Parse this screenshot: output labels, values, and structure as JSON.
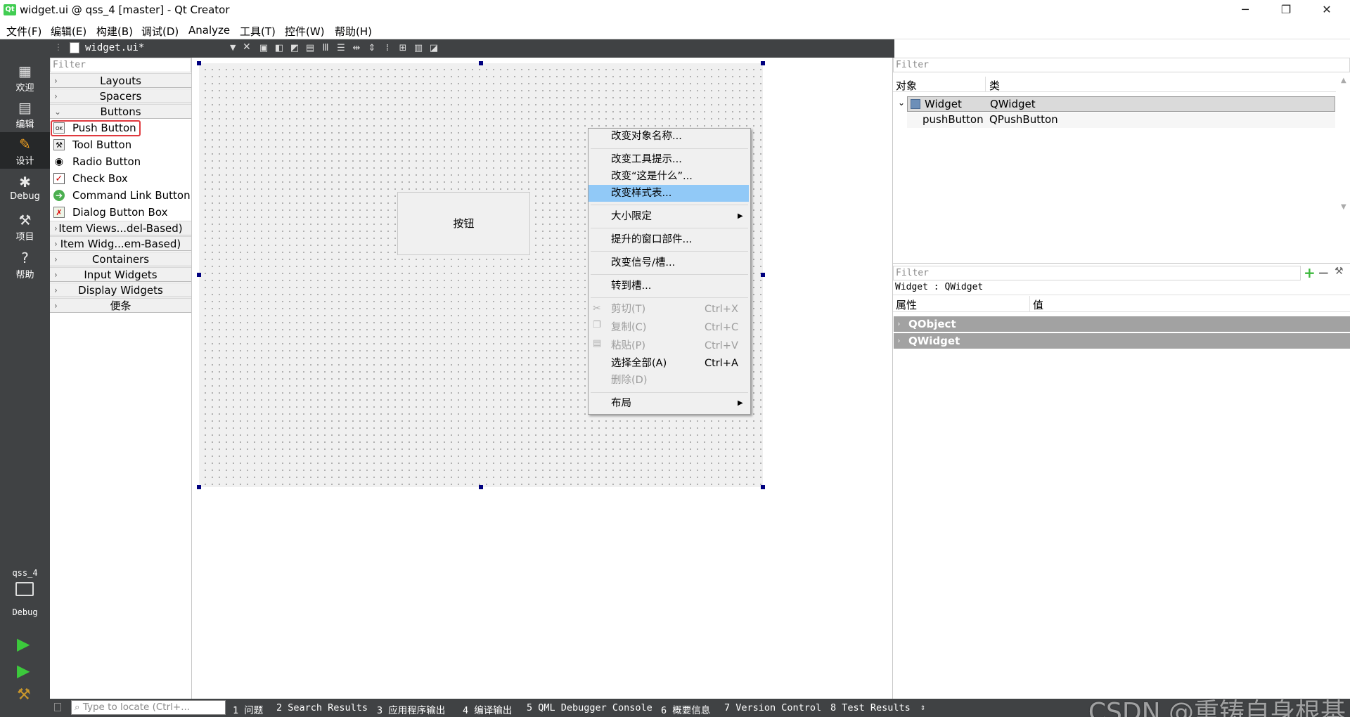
{
  "window": {
    "title": "widget.ui @ qss_4 [master] - Qt Creator",
    "app_icon": "Qt",
    "minimize": "─",
    "restore": "❐",
    "close": "✕"
  },
  "menu": [
    "文件(F)",
    "编辑(E)",
    "构建(B)",
    "调试(D)",
    "Analyze",
    "工具(T)",
    "控件(W)",
    "帮助(H)"
  ],
  "modes": [
    {
      "label": "欢迎",
      "icon": "grid-icon"
    },
    {
      "label": "编辑",
      "icon": "document-icon"
    },
    {
      "label": "设计",
      "icon": "pencil-icon"
    },
    {
      "label": "Debug",
      "icon": "bug-icon"
    },
    {
      "label": "项目",
      "icon": "wrench-icon"
    },
    {
      "label": "帮助",
      "icon": "help-icon"
    }
  ],
  "kit": {
    "project": "qss_4",
    "config": "Debug"
  },
  "editor_tab": {
    "filename": "widget.ui*"
  },
  "widget_box": {
    "filter_placeholder": "Filter",
    "categories_top": [
      "Layouts",
      "Spacers",
      "Buttons"
    ],
    "buttons": [
      "Push Button",
      "Tool Button",
      "Radio Button",
      "Check Box",
      "Command Link Button",
      "Dialog Button Box"
    ],
    "categories_bottom": [
      "Item Views...del-Based)",
      "Item Widg...em-Based)",
      "Containers",
      "Input Widgets",
      "Display Widgets",
      "便条"
    ]
  },
  "form": {
    "push_button_text": "按钮"
  },
  "context_menu": {
    "items": [
      "改变对象名称...",
      "改变工具提示...",
      "改变“这是什么”...",
      "改变样式表...",
      "大小限定",
      "提升的窗口部件...",
      "改变信号/槽...",
      "转到槽...",
      "剪切(T)",
      "复制(C)",
      "粘贴(P)",
      "选择全部(A)",
      "删除(D)",
      "布局"
    ],
    "shortcuts": {
      "cut": "Ctrl+X",
      "copy": "Ctrl+C",
      "paste": "Ctrl+V",
      "select_all": "Ctrl+A"
    },
    "highlight_color": "#91c9f7"
  },
  "object_inspector": {
    "filter_placeholder": "Filter",
    "col_object": "对象",
    "col_class": "类",
    "rows": [
      {
        "object": "Widget",
        "class": "QWidget"
      },
      {
        "object": "pushButton",
        "class": "QPushButton"
      }
    ]
  },
  "property_editor": {
    "filter_placeholder": "Filter",
    "context": "Widget : QWidget",
    "col_property": "属性",
    "col_value": "值",
    "groups": [
      "QObject",
      "QWidget"
    ]
  },
  "status_bar": {
    "locate_placeholder": "Type to locate (Ctrl+...",
    "panes": [
      "1 问题",
      "2 Search Results",
      "3 应用程序输出",
      "4 编译输出",
      "5 QML Debugger Console",
      "6 概要信息",
      "7 Version Control",
      "8 Test Results"
    ]
  },
  "watermark": "CSDN @重铸自身根基"
}
